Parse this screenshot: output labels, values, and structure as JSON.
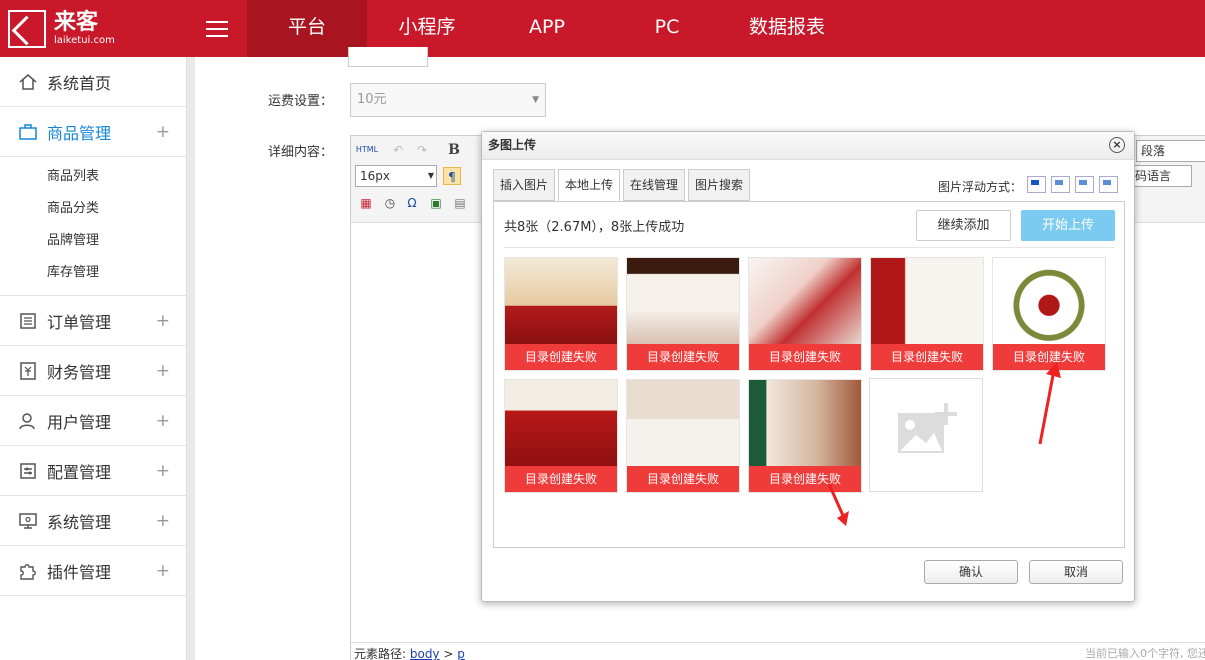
{
  "brand": {
    "name_cn": "来客",
    "domain": "laiketui.com"
  },
  "topnav": [
    {
      "label": "平台",
      "active": true
    },
    {
      "label": "小程序",
      "active": false
    },
    {
      "label": "APP",
      "active": false
    },
    {
      "label": "PC",
      "active": false
    },
    {
      "label": "数据报表",
      "active": false
    }
  ],
  "sidebar": {
    "home": "系统首页",
    "goods": "商品管理",
    "goods_sub": [
      "商品列表",
      "商品分类",
      "品牌管理",
      "库存管理"
    ],
    "orders": "订单管理",
    "finance": "财务管理",
    "users": "用户管理",
    "config": "配置管理",
    "system": "系统管理",
    "plugins": "插件管理",
    "plus": "+"
  },
  "form": {
    "shipping_label": "运费设置：",
    "shipping_value": "10元",
    "detail_label": "详细内容："
  },
  "editor": {
    "html_btn": "HTML",
    "font_size": "16px",
    "paragraph": "段落",
    "code_lang": "码语言",
    "status_prefix": "元素路径: ",
    "path_body": "body",
    "path_sep": " > ",
    "path_p": "p",
    "char_count": "当前已输入0个字符, 您还"
  },
  "dialog": {
    "title": "多图上传",
    "close": "×",
    "tabs": [
      "插入图片",
      "本地上传",
      "在线管理",
      "图片搜索"
    ],
    "active_tab": 1,
    "float_label": "图片浮动方式：",
    "info": "共8张（2.67M），8张上传成功",
    "continue_btn": "继续添加",
    "start_btn": "开始上传",
    "error_text": "目录创建失败",
    "ok": "确认",
    "cancel": "取消"
  },
  "colors": {
    "brand_red": "#c8182a",
    "error_red": "#f03b3b",
    "accent_blue": "#1585d8",
    "start_blue": "#7bcbf0"
  }
}
